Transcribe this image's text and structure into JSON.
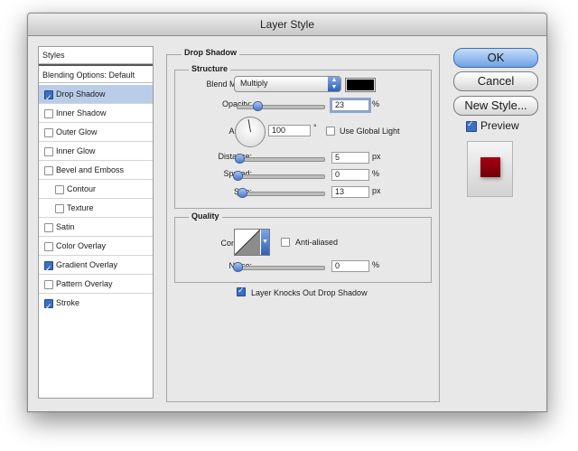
{
  "dialog": {
    "title": "Layer Style"
  },
  "styles_list": {
    "header": "Styles",
    "blending": "Blending Options: Default",
    "items": [
      {
        "label": "Drop Shadow",
        "checked": true,
        "selected": true
      },
      {
        "label": "Inner Shadow",
        "checked": false
      },
      {
        "label": "Outer Glow",
        "checked": false
      },
      {
        "label": "Inner Glow",
        "checked": false
      },
      {
        "label": "Bevel and Emboss",
        "checked": false
      },
      {
        "label": "Contour",
        "checked": false,
        "indent": true
      },
      {
        "label": "Texture",
        "checked": false,
        "indent": true
      },
      {
        "label": "Satin",
        "checked": false
      },
      {
        "label": "Color Overlay",
        "checked": false
      },
      {
        "label": "Gradient Overlay",
        "checked": true
      },
      {
        "label": "Pattern Overlay",
        "checked": false
      },
      {
        "label": "Stroke",
        "checked": true
      }
    ]
  },
  "drop_shadow": {
    "title": "Drop Shadow",
    "structure": {
      "title": "Structure",
      "blend_mode_label": "Blend Mode:",
      "blend_mode_value": "Multiply",
      "shadow_color": "#000000",
      "opacity_label": "Opacity:",
      "opacity_value": "23",
      "opacity_unit": "%",
      "opacity_fraction": 0.23,
      "angle_label": "Angle:",
      "angle_value": "100",
      "angle_unit": "°",
      "use_global_light": "Use Global Light",
      "distance_label": "Distance:",
      "distance_value": "5",
      "distance_unit": "px",
      "distance_fraction": 0.02,
      "spread_label": "Spread:",
      "spread_value": "0",
      "spread_unit": "%",
      "spread_fraction": 0.0,
      "size_label": "Size:",
      "size_value": "13",
      "size_unit": "px",
      "size_fraction": 0.05
    },
    "quality": {
      "title": "Quality",
      "contour_label": "Contour:",
      "anti_aliased": "Anti-aliased",
      "noise_label": "Noise:",
      "noise_value": "0",
      "noise_unit": "%",
      "noise_fraction": 0.0
    },
    "knockout": "Layer Knocks Out Drop Shadow"
  },
  "buttons": {
    "ok": "OK",
    "cancel": "Cancel",
    "new_style": "New Style...",
    "preview": "Preview"
  },
  "colors": {
    "selection": "#b9cde8",
    "accent": "#3a6fc2",
    "preview_swatch": "#a80012"
  }
}
